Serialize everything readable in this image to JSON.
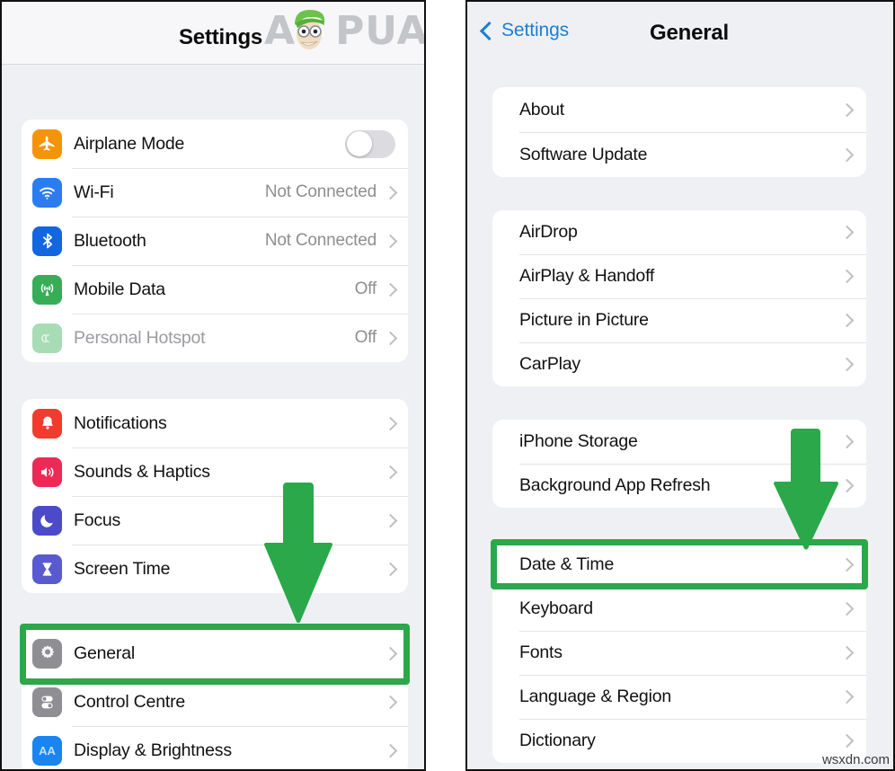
{
  "branding": {
    "logo_text_a": "A",
    "logo_text_rest": "PUALS",
    "watermark": "wsxdn.com",
    "accent_green": "#2aa84a",
    "link_blue": "#1b7fd4"
  },
  "left_panel": {
    "nav": {
      "title": "Settings",
      "logo_icon": "appuals-logo"
    },
    "groups": [
      {
        "name": "connectivity",
        "rows": [
          {
            "label": "Airplane Mode",
            "icon": "airplane-icon",
            "icon_color": "#f5930a",
            "control": "toggle",
            "toggle_on": false
          },
          {
            "label": "Wi-Fi",
            "icon": "wifi-icon",
            "icon_color": "#2b7cf0",
            "value": "Not Connected",
            "control": "chevron"
          },
          {
            "label": "Bluetooth",
            "icon": "bluetooth-icon",
            "icon_color": "#1266e0",
            "value": "Not Connected",
            "control": "chevron"
          },
          {
            "label": "Mobile Data",
            "icon": "mobile-data-icon",
            "icon_color": "#37ad56",
            "value": "Off",
            "control": "chevron"
          },
          {
            "label": "Personal Hotspot",
            "icon": "hotspot-icon",
            "icon_color": "#a8dcb4",
            "value": "Off",
            "control": "chevron",
            "dimmed": true
          }
        ]
      },
      {
        "name": "alerts",
        "rows": [
          {
            "label": "Notifications",
            "icon": "bell-icon",
            "icon_color": "#f23b2f",
            "control": "chevron"
          },
          {
            "label": "Sounds & Haptics",
            "icon": "speaker-icon",
            "icon_color": "#ec2a55",
            "control": "chevron"
          },
          {
            "label": "Focus",
            "icon": "moon-icon",
            "icon_color": "#4b4bc9",
            "control": "chevron"
          },
          {
            "label": "Screen Time",
            "icon": "hourglass-icon",
            "icon_color": "#5a5ad0",
            "control": "chevron"
          }
        ]
      },
      {
        "name": "system",
        "rows": [
          {
            "label": "General",
            "icon": "gear-icon",
            "icon_color": "#8e8e93",
            "control": "chevron",
            "highlighted": true
          },
          {
            "label": "Control Centre",
            "icon": "control-centre-icon",
            "icon_color": "#8e8e93",
            "control": "chevron"
          },
          {
            "label": "Display & Brightness",
            "icon": "display-brightness-icon",
            "icon_color": "#1a84f0",
            "control": "chevron"
          }
        ]
      }
    ],
    "annotation": {
      "arrow": "down-arrow",
      "highlight_target": "General"
    }
  },
  "right_panel": {
    "nav": {
      "back_label": "Settings",
      "title": "General",
      "logo_icon": "appuals-logo"
    },
    "groups": [
      {
        "name": "info",
        "rows": [
          {
            "label": "About",
            "control": "chevron"
          },
          {
            "label": "Software Update",
            "control": "chevron"
          }
        ]
      },
      {
        "name": "connectivity-features",
        "rows": [
          {
            "label": "AirDrop",
            "control": "chevron"
          },
          {
            "label": "AirPlay & Handoff",
            "control": "chevron"
          },
          {
            "label": "Picture in Picture",
            "control": "chevron"
          },
          {
            "label": "CarPlay",
            "control": "chevron"
          }
        ]
      },
      {
        "name": "storage",
        "rows": [
          {
            "label": "iPhone Storage",
            "control": "chevron"
          },
          {
            "label": "Background App Refresh",
            "control": "chevron"
          }
        ]
      },
      {
        "name": "localization",
        "rows": [
          {
            "label": "Date & Time",
            "control": "chevron",
            "highlighted": true
          },
          {
            "label": "Keyboard",
            "control": "chevron"
          },
          {
            "label": "Fonts",
            "control": "chevron"
          },
          {
            "label": "Language & Region",
            "control": "chevron"
          },
          {
            "label": "Dictionary",
            "control": "chevron"
          }
        ]
      }
    ],
    "annotation": {
      "arrow": "down-arrow",
      "highlight_target": "Date & Time"
    }
  }
}
